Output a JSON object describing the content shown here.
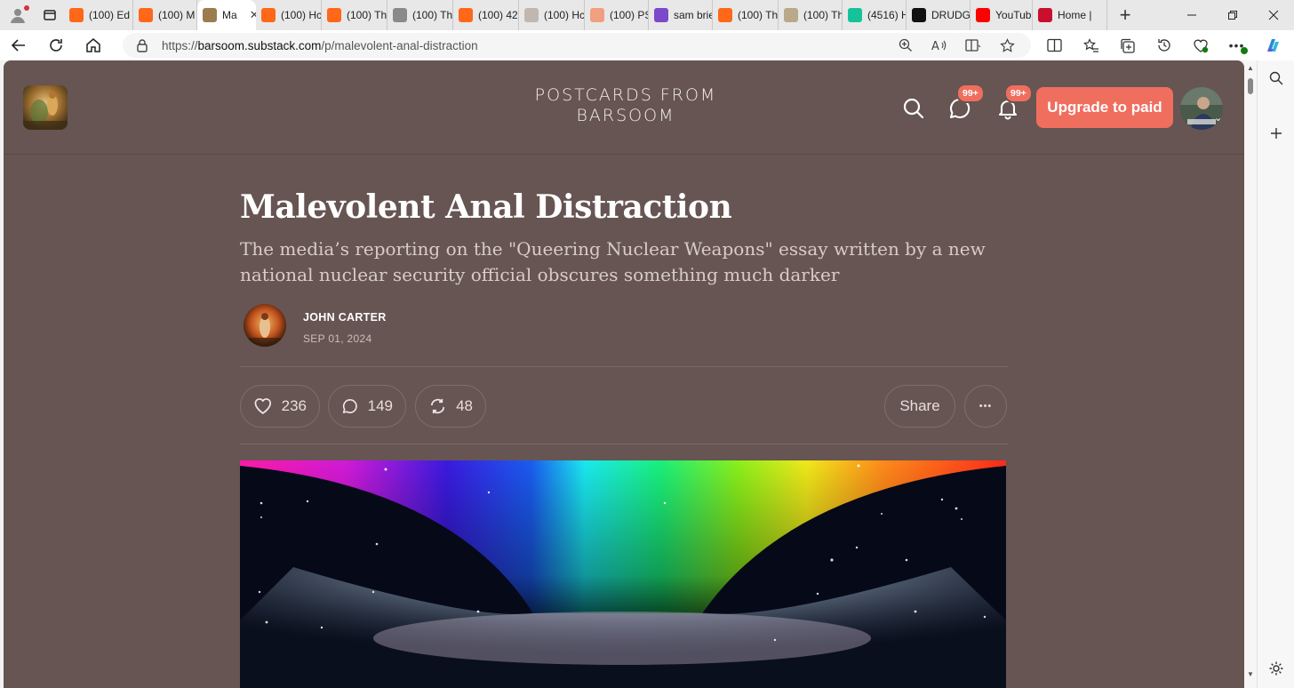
{
  "browser": {
    "tabs": [
      {
        "label": "(100) Ed",
        "icon": "substack-favicon-icon",
        "color": "#ff6719"
      },
      {
        "label": "(100) M",
        "icon": "substack-favicon-icon",
        "color": "#ff6719"
      },
      {
        "label": "Ma",
        "icon": "barsoom-favicon-icon",
        "color": "#9c7b4f",
        "active": true
      },
      {
        "label": "(100) Hc",
        "icon": "substack-favicon-icon",
        "color": "#ff6719"
      },
      {
        "label": "(100) Th",
        "icon": "substack-favicon-icon",
        "color": "#ff6719"
      },
      {
        "label": "(100) Th",
        "icon": "image-favicon-icon",
        "color": "#8a8a8a"
      },
      {
        "label": "(100) 42",
        "icon": "substack-favicon-icon",
        "color": "#ff6719"
      },
      {
        "label": "(100) Hc",
        "icon": "image-favicon-icon",
        "color": "#c0b8b0"
      },
      {
        "label": "(100) PS",
        "icon": "substack-favicon-icon",
        "color": "#f0a080"
      },
      {
        "label": "sam brie",
        "icon": "yahoo-favicon-icon",
        "color": "#7b49c9"
      },
      {
        "label": "(100) Th",
        "icon": "substack-favicon-icon",
        "color": "#ff6719"
      },
      {
        "label": "(100) Th",
        "icon": "image-favicon-icon",
        "color": "#b9a98a"
      },
      {
        "label": "(4516) H",
        "icon": "grammarly-favicon-icon",
        "color": "#15c39a"
      },
      {
        "label": "DRUDGE",
        "icon": "drudge-favicon-icon",
        "color": "#111111"
      },
      {
        "label": "YouTube",
        "icon": "youtube-favicon-icon",
        "color": "#ff0000"
      },
      {
        "label": "Home |",
        "icon": "red-favicon-icon",
        "color": "#c8102e"
      }
    ],
    "tab_close": "✕",
    "new_tab": "+",
    "url_prefix": "https://",
    "url_host": "barsoom.substack.com",
    "url_path": "/p/malevolent-anal-distraction"
  },
  "site": {
    "title_line1": "POSTCARDS FROM",
    "title_line2": "BARSOOM",
    "chat_badge": "99+",
    "bell_badge": "99+",
    "upgrade_label": "Upgrade to paid",
    "accent": "#ef6e5e",
    "background": "#665552"
  },
  "article": {
    "title": "Malevolent Anal Distraction",
    "subtitle": "The media’s reporting on the \"Queering Nuclear Weapons\" essay written by a new national nuclear security official obscures something much darker",
    "author": "JOHN CARTER",
    "date": "SEP 01, 2024",
    "likes": "236",
    "comments": "149",
    "restacks": "48",
    "share_label": "Share",
    "more_label": "•••"
  }
}
